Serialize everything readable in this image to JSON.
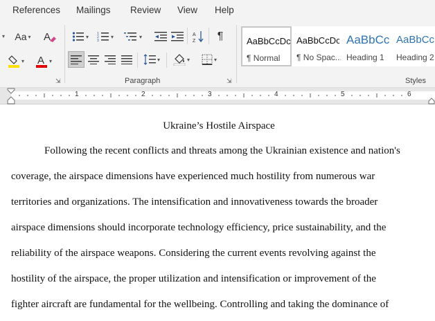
{
  "menu": {
    "tabs": [
      "References",
      "Mailings",
      "Review",
      "View",
      "Help"
    ]
  },
  "ribbon": {
    "font_group": {
      "change_case_label": "Aa"
    },
    "paragraph_group": {
      "label": "Paragraph"
    },
    "styles_group": {
      "label": "Styles",
      "items": [
        {
          "sample": "AaBbCcDc",
          "name": "¶ Normal"
        },
        {
          "sample": "AaBbCcDc",
          "name": "¶ No Spac..."
        },
        {
          "sample": "AaBbCc",
          "name": "Heading 1"
        },
        {
          "sample": "AaBbCcD",
          "name": "Heading 2"
        }
      ]
    },
    "colors": {
      "highlight": "#ffe000",
      "font_color": "#e00000",
      "heading_blue": "#2e74b5"
    }
  },
  "ruler": {
    "numbers": [
      "1",
      "2",
      "3",
      "4",
      "5",
      "6"
    ]
  },
  "document": {
    "title": "Ukraine’s Hostile Airspace",
    "lines": [
      "Following the recent conflicts and threats among the Ukrainian existence and nation's",
      "coverage, the airspace dimensions have experienced much hostility from numerous war",
      "territories and organizations. The intensification and innovativeness towards the broader",
      "airspace dimensions should incorporate technology efficiency, price sustainability, and the",
      "reliability of the airspace weapons. Considering the current events revolving against the",
      "hostility of the airspace, the proper utilization and intensification or improvement of the",
      "fighter aircraft are fundamental for the wellbeing. Controlling and taking the dominance of"
    ]
  }
}
